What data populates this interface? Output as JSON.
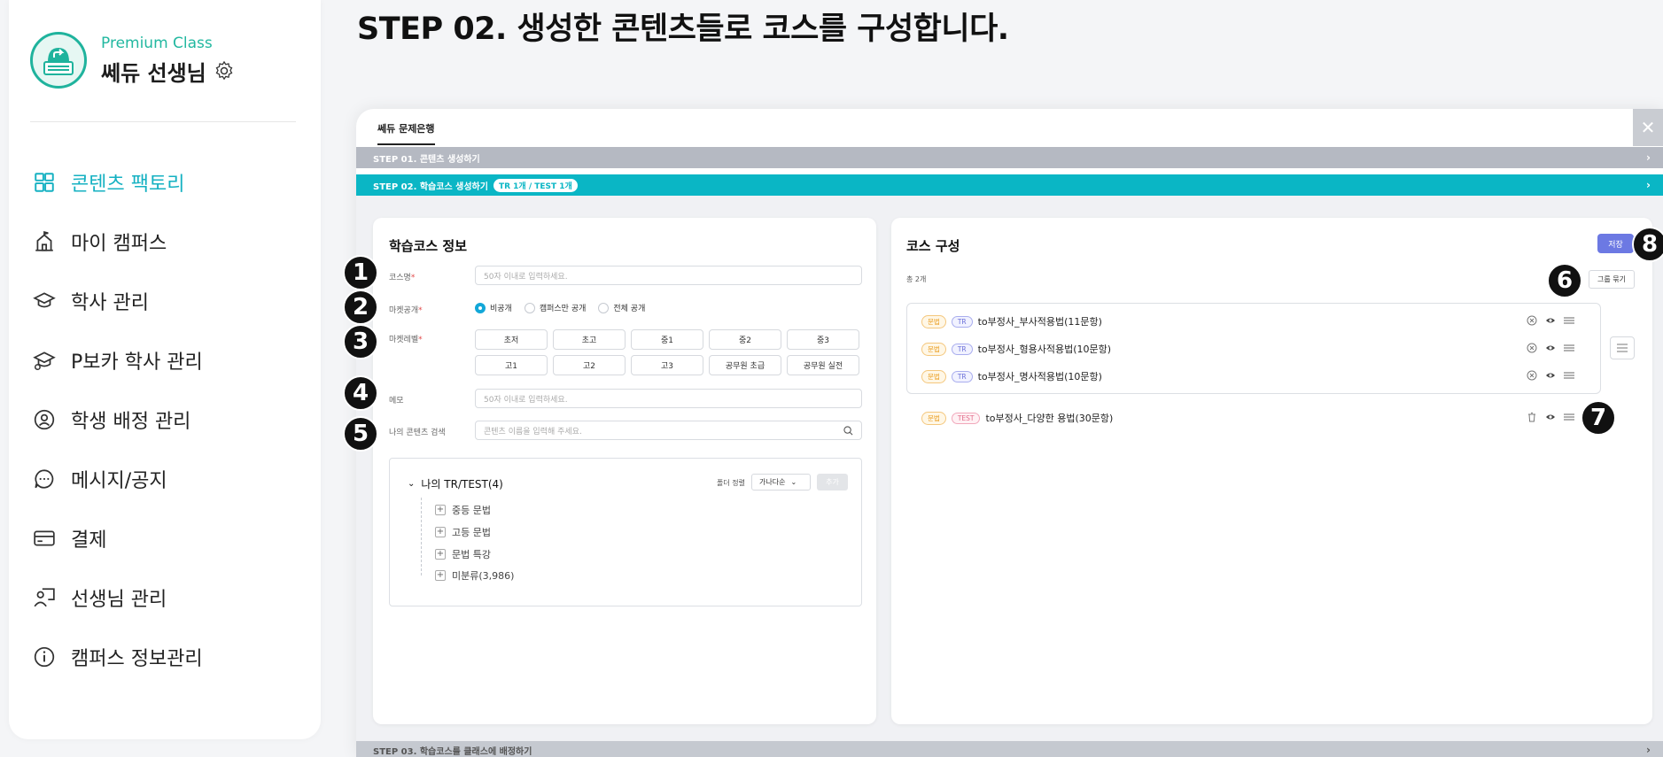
{
  "sidebar": {
    "premium": "Premium Class",
    "teacher": "쎄듀 선생님",
    "items": [
      {
        "label": "콘텐츠 팩토리",
        "icon": "grid-icon"
      },
      {
        "label": "마이 캠퍼스",
        "icon": "campus-icon"
      },
      {
        "label": "학사 관리",
        "icon": "graduation-cap-icon"
      },
      {
        "label": "P보카 학사 관리",
        "icon": "graduation-cap-person-icon"
      },
      {
        "label": "학생 배정 관리",
        "icon": "student-assign-icon"
      },
      {
        "label": "메시지/공지",
        "icon": "chat-icon"
      },
      {
        "label": "결제",
        "icon": "credit-card-icon"
      },
      {
        "label": "선생님 관리",
        "icon": "teacher-icon"
      },
      {
        "label": "캠퍼스 정보관리",
        "icon": "info-icon"
      }
    ]
  },
  "heading": "STEP 02. 생성한 콘텐츠들로 코스를 구성합니다.",
  "window": {
    "tab": "쎄듀 문제은행",
    "close": "✕",
    "step1": "STEP 01. 콘텐츠 생성하기",
    "step2": "STEP 02. 학습코스 생성하기",
    "step2_pill": "TR 1개 / TEST 1개",
    "step3": "STEP 03. 학습코스를 클래스에 배정하기"
  },
  "course_info": {
    "title": "학습코스 정보",
    "name_label": "코스명",
    "name_placeholder": "50자 이내로 입력하세요.",
    "market_label": "마켓공개",
    "market_options": [
      "비공개",
      "캠퍼스만 공개",
      "전체 공개"
    ],
    "level_label": "마켓레벨",
    "levels": [
      "초저",
      "초고",
      "중1",
      "중2",
      "중3",
      "고1",
      "고2",
      "고3",
      "공무원 초급",
      "공무원 실전"
    ],
    "memo_label": "메모",
    "memo_placeholder": "50자 이내로 입력하세요.",
    "search_label": "나의 콘텐츠 검색",
    "search_placeholder": "콘텐츠 이름을 입력해 주세요.",
    "tree": {
      "title": "나의 TR/TEST(4)",
      "sort_label": "폴더 정렬",
      "sort_value": "가나다순",
      "add": "추가",
      "items": [
        "중등 문법",
        "고등 문법",
        "문법 특강",
        "미분류(3,986)"
      ]
    }
  },
  "course_build": {
    "title": "코스 구성",
    "save": "저장",
    "total": "총 2개",
    "group_btn": "그룹 묶기",
    "grouped": [
      {
        "tag1": "문법",
        "tag2": "TR",
        "name": "to부정사_부사적용법(11문항)"
      },
      {
        "tag1": "문법",
        "tag2": "TR",
        "name": "to부정사_형용사적용법(10문항)"
      },
      {
        "tag1": "문법",
        "tag2": "TR",
        "name": "to부정사_명사적용법(10문항)"
      }
    ],
    "single": {
      "tag1": "문법",
      "tag2": "TEST",
      "name": "to부정사_다양한 용법(30문항)"
    }
  },
  "badges": [
    "1",
    "2",
    "3",
    "4",
    "5",
    "6",
    "7",
    "8"
  ],
  "colors": {
    "accent": "#0ab6c5",
    "active_menu": "#15b1c2",
    "save": "#6c79e3",
    "premium": "#22b8a0"
  }
}
